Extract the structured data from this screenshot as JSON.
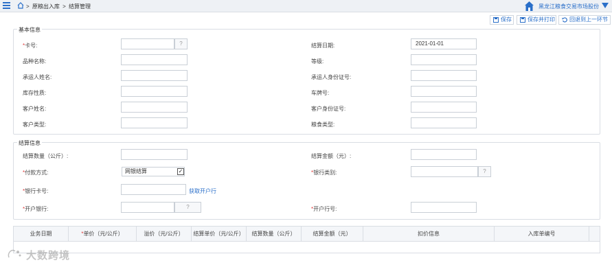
{
  "header": {
    "breadcrumb": [
      ">",
      "原粮出入库",
      ">",
      "结算管理"
    ],
    "org_name": "黑龙江粮食交易市场股份"
  },
  "toolbar": {
    "save_label": "保存",
    "save_print_label": "保存并打印",
    "back_label": "回退到上一环节"
  },
  "basic_info": {
    "legend": "基本信息",
    "card_no_label": "卡号:",
    "card_no_value": "",
    "card_no_suffix": "?",
    "settle_date_label": "结算日期:",
    "settle_date_value": "2021-01-01",
    "variety_label": "品种名称:",
    "variety_value": "",
    "grade_label": "等级:",
    "grade_value": "",
    "carrier_name_label": "承运人姓名:",
    "carrier_name_value": "",
    "carrier_id_label": "承运人身份证号:",
    "carrier_id_value": "",
    "stock_nature_label": "库存性质:",
    "stock_nature_value": "",
    "plate_label": "车牌号:",
    "plate_value": "",
    "customer_name_label": "客户姓名:",
    "customer_name_value": "",
    "customer_id_label": "客户身份证号:",
    "customer_id_value": "",
    "customer_type_label": "客户类型:",
    "customer_type_value": "",
    "grain_type_label": "粮食类型:",
    "grain_type_value": ""
  },
  "settle_info": {
    "legend": "结算信息",
    "quantity_label": "结算数量（公斤）:",
    "quantity_value": "",
    "amount_label": "结算金额（元）:",
    "amount_value": "",
    "pay_method_label": "付款方式:",
    "pay_method_value": "网银结算",
    "bank_type_label": "银行类别:",
    "bank_type_value": "",
    "bank_type_suffix": "?",
    "bank_card_label": "银行卡号:",
    "bank_card_value": "",
    "get_bank_link": "获取开户行",
    "open_bank_label": "开户银行:",
    "open_bank_value": "",
    "open_bank_suffix": "?",
    "bank_no_label": "开户行号:",
    "bank_no_value": ""
  },
  "table": {
    "columns": [
      "业务日期",
      "单价（元/公斤）",
      "溢价（元/公斤）",
      "结算单价（元/公斤）",
      "结算数量（公斤）",
      "结算金额（元）",
      "扣价信息",
      "入库单编号"
    ],
    "required_column_index": 1,
    "rows": []
  },
  "watermark": "大数跨境",
  "colors": {
    "accent": "#2a6fc9",
    "required": "#e03c3c",
    "border": "#d9dde3"
  }
}
